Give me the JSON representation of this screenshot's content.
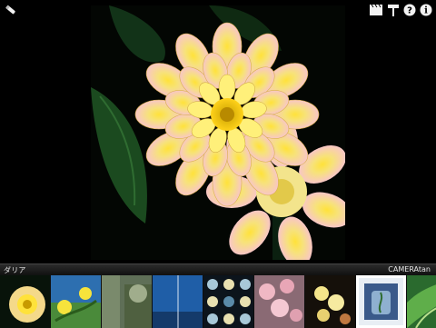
{
  "toolbar": {
    "buttons": [
      {
        "name": "edit-icon",
        "label": ""
      },
      {
        "name": "slideshow-icon",
        "label": ""
      },
      {
        "name": "paint-roller-icon",
        "label": ""
      },
      {
        "name": "help-icon",
        "label": "?"
      },
      {
        "name": "info-icon",
        "label": "i"
      }
    ]
  },
  "photo": {
    "title": "ダリア"
  },
  "bottom_bar": {
    "caption": "ダリア",
    "brand": "CAMERAtan",
    "selected_index": 7
  },
  "thumbnails": [
    {
      "name": "dahlia"
    },
    {
      "name": "yellow-flowers"
    },
    {
      "name": "greenery"
    },
    {
      "name": "blue-sky"
    },
    {
      "name": "dots-pattern"
    },
    {
      "name": "pink-blossoms"
    },
    {
      "name": "yellow-blossoms"
    },
    {
      "name": "jar-with-plant"
    },
    {
      "name": "leaves"
    }
  ],
  "colors": {
    "background": "#000000",
    "selection_border": "#ffffff"
  }
}
